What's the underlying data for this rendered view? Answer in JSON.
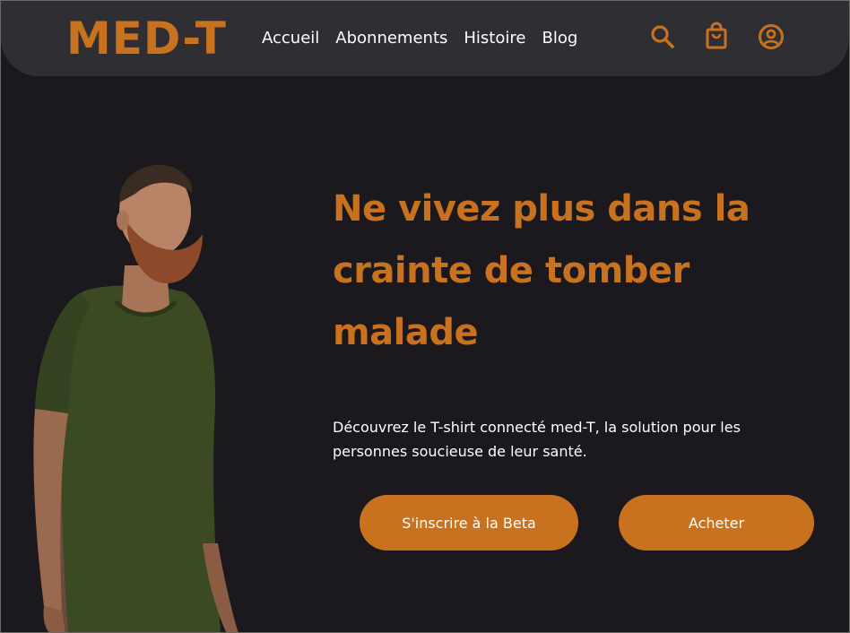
{
  "brand": {
    "logo": "MED-T",
    "accent_color": "#c8711e"
  },
  "nav": {
    "links": [
      {
        "label": "Accueil"
      },
      {
        "label": "Abonnements"
      },
      {
        "label": "Histoire"
      },
      {
        "label": "Blog"
      }
    ],
    "icons": [
      "search-icon",
      "shopping-bag-icon",
      "user-account-icon"
    ]
  },
  "hero": {
    "headline": "Ne vivez plus dans la crainte de tomber malade",
    "subtitle": "Découvrez le T-shirt connecté med-T, la solution pour les personnes soucieuse de leur santé.",
    "buttons": {
      "beta": "S'inscrire à la Beta",
      "buy": "Acheter"
    },
    "image": "bearded-man-green-tshirt"
  }
}
